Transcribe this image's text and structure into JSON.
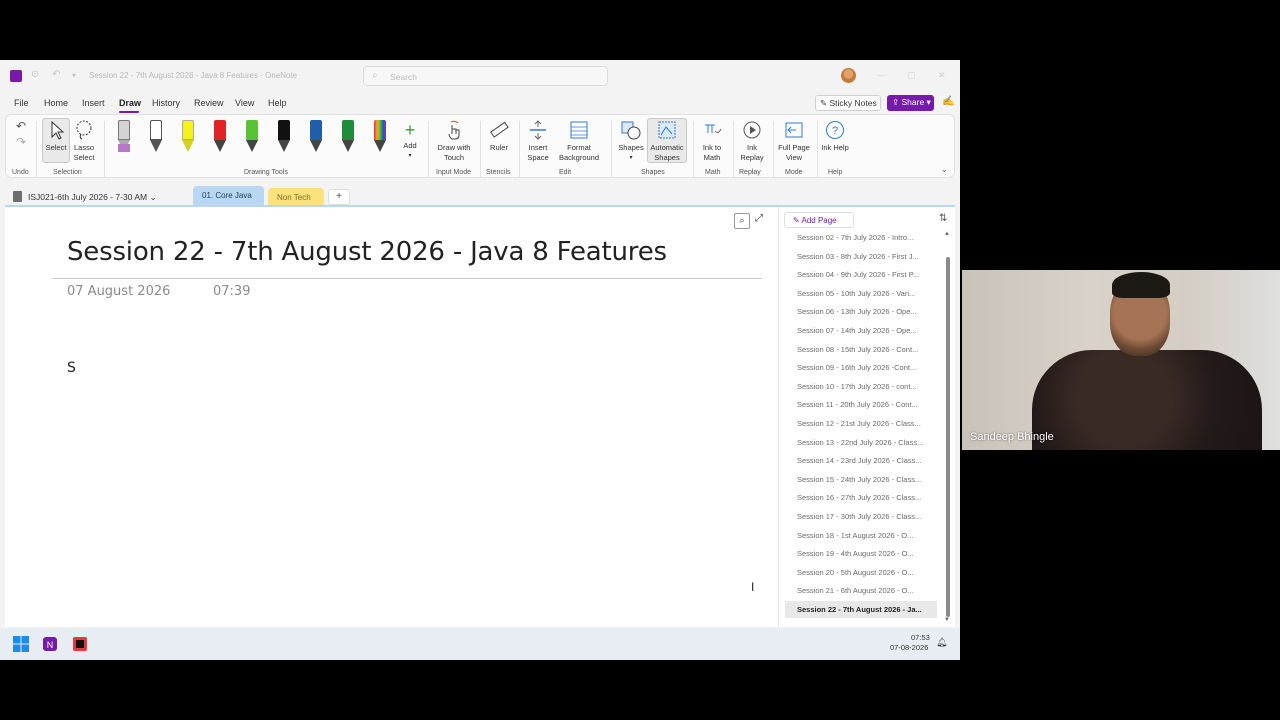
{
  "window": {
    "title": "Session 22 - 7th August 2026 - Java 8 Features  -  OneNote",
    "search_placeholder": "Search"
  },
  "menu": {
    "items": [
      "File",
      "Home",
      "Insert",
      "Draw",
      "History",
      "Review",
      "View",
      "Help"
    ],
    "active": "Draw",
    "sticky_notes": "Sticky Notes",
    "share": "Share"
  },
  "ribbon": {
    "undo_group": "Undo",
    "select": "Select",
    "lasso": "Lasso Select",
    "selection_group": "Selection",
    "add": "Add",
    "drawing_tools_group": "Drawing Tools",
    "draw_with_touch": "Draw with Touch",
    "input_mode_group": "Input Mode",
    "ruler": "Ruler",
    "stencils_group": "Stencils",
    "insert_space": "Insert Space",
    "format_background": "Format Background",
    "edit_group": "Edit",
    "shapes": "Shapes",
    "automatic_shapes": "Automatic Shapes",
    "shapes_group": "Shapes",
    "ink_to_math": "Ink to Math",
    "math_group": "Math",
    "ink_replay": "Ink Replay",
    "replay_group": "Replay",
    "full_page_view": "Full Page View",
    "mode_group": "Mode",
    "ink_help": "Ink Help",
    "help_group": "Help",
    "pen_colors": [
      "#c8c8c8",
      "#ffffff",
      "#f5f21a",
      "#e02424",
      "#5bc236",
      "#111111",
      "#1f5fa8",
      "#1e8c3a",
      "#e05a9a"
    ]
  },
  "tabs": {
    "notebook": "ISJ021-6th July 2026 - 7-30 AM",
    "sections": [
      "01. Core Java",
      "Non Tech"
    ],
    "add": "+"
  },
  "page": {
    "title": "Session 22 - 7th August 2026 - Java 8 Features",
    "date": "07 August 2026",
    "time": "07:39",
    "body": "S"
  },
  "pages_pane": {
    "add_page": "Add Page",
    "items": [
      "Session 02 - 7th July 2026 - Intro...",
      "Session 03 - 8th July 2026 - First J...",
      "Session 04 - 9th July 2026 - First P...",
      "Session 05 - 10th July 2026 - Vari...",
      "Session 06 - 13th July 2026 - Ope...",
      "Session 07 - 14th July 2026 - Ope...",
      "Session 08 - 15th July 2026 - Cont...",
      "Session 09 - 16th July 2026 -Cont...",
      "Session 10 - 17th July 2026 - cont...",
      "Session 11 - 20th July 2026 - Cont...",
      "Session 12 - 21st July 2026 - Class...",
      "Session 13 - 22nd July 2026 - Class...",
      "Session 14 - 23rd July 2026 - Class...",
      "Session 15 - 24th July 2026 - Class...",
      "Session 16 - 27th July 2026 - Class...",
      "Session 17 - 30th July 2026 - Class...",
      "Session 18 - 1st August 2026 - O...",
      "Session 19 - 4th August 2026 - O...",
      "Session 20 - 5th August 2026 - O...",
      "Session 21 - 6th August 2026 - O...",
      "Session 22 - 7th August 2026 - Ja..."
    ],
    "active_index": 20
  },
  "taskbar": {
    "time": "07:53",
    "date": "07-08-2026"
  },
  "webcam": {
    "name": "Sandeep Bhingle"
  }
}
